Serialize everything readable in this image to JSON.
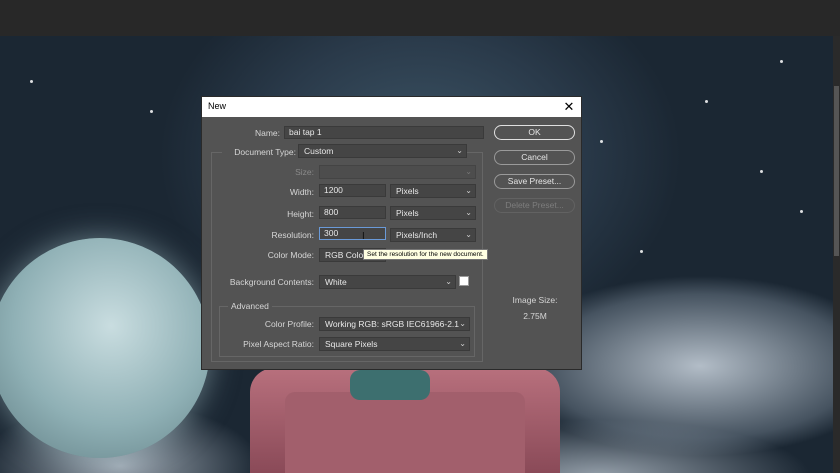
{
  "dialog": {
    "title": "New",
    "name_label": "Name:",
    "name_value": "bai tap 1",
    "document_type_label": "Document Type:",
    "document_type_value": "Custom",
    "size_label": "Size:",
    "size_value": "",
    "width_label": "Width:",
    "width_value": "1200",
    "width_unit": "Pixels",
    "height_label": "Height:",
    "height_value": "800",
    "height_unit": "Pixels",
    "resolution_label": "Resolution:",
    "resolution_value": "300",
    "resolution_unit": "Pixels/Inch",
    "color_mode_label": "Color Mode:",
    "color_mode_value": "RGB Color",
    "background_label": "Background Contents:",
    "background_value": "White",
    "advanced_label": "Advanced",
    "color_profile_label": "Color Profile:",
    "color_profile_value": "Working RGB:  sRGB IEC61966-2.1",
    "pixel_aspect_label": "Pixel Aspect Ratio:",
    "pixel_aspect_value": "Square Pixels",
    "image_size_label": "Image Size:",
    "image_size_value": "2.75M",
    "tooltip": "Set the resolution for the new document.",
    "buttons": {
      "ok": "OK",
      "cancel": "Cancel",
      "save_preset": "Save Preset...",
      "delete_preset": "Delete Preset..."
    }
  },
  "icons": {
    "close": "close-icon",
    "chevron": "chevron-down-icon",
    "cursor": "text-cursor-icon"
  },
  "colors": {
    "dialog_bg": "#535353",
    "field_bg": "#454545",
    "focus_border": "#6a9ad8",
    "tooltip_bg": "#ffffe1",
    "background_swatch": "#ffffff"
  }
}
